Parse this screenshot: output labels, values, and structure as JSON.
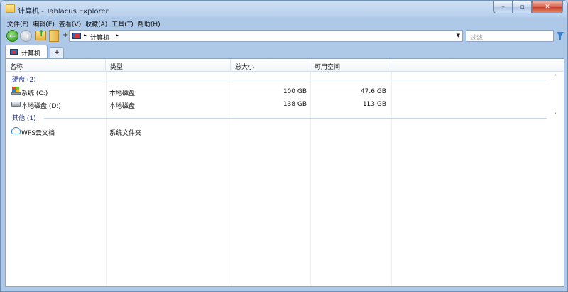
{
  "window": {
    "title": "计算机 - Tablacus Explorer"
  },
  "caption_buttons": {
    "min": "–",
    "max": "▫",
    "close": "✕"
  },
  "menu": [
    "文件(F)",
    "编辑(E)",
    "查看(V)",
    "收藏(A)",
    "工具(T)",
    "帮助(H)"
  ],
  "toolbar": {
    "back_glyph": "←",
    "forward_glyph": "→",
    "add_glyph": "+",
    "address": "计算机",
    "address_sep": "▸",
    "dropdown_glyph": "▼",
    "filter_placeholder": "过滤"
  },
  "tabs": {
    "active_label": "计算机",
    "add_glyph": "+"
  },
  "columns": {
    "name": "名称",
    "type": "类型",
    "total": "总大小",
    "free": "可用空间",
    "sort_glyph": "ˆ"
  },
  "groups": [
    {
      "label": "硬盘 (2)",
      "items": [
        {
          "name": "系统 (C:)",
          "type": "本地磁盘",
          "total": "100 GB",
          "free": "47.6 GB",
          "icon": "windows-drive-icon"
        },
        {
          "name": "本地磁盘 (D:)",
          "type": "本地磁盘",
          "total": "138 GB",
          "free": "113 GB",
          "icon": "hard-drive-icon"
        }
      ]
    },
    {
      "label": "其他 (1)",
      "items": [
        {
          "name": "WPS云文档",
          "type": "系统文件夹",
          "total": "",
          "free": "",
          "icon": "cloud-icon"
        }
      ]
    }
  ],
  "group_chevron": "˄"
}
